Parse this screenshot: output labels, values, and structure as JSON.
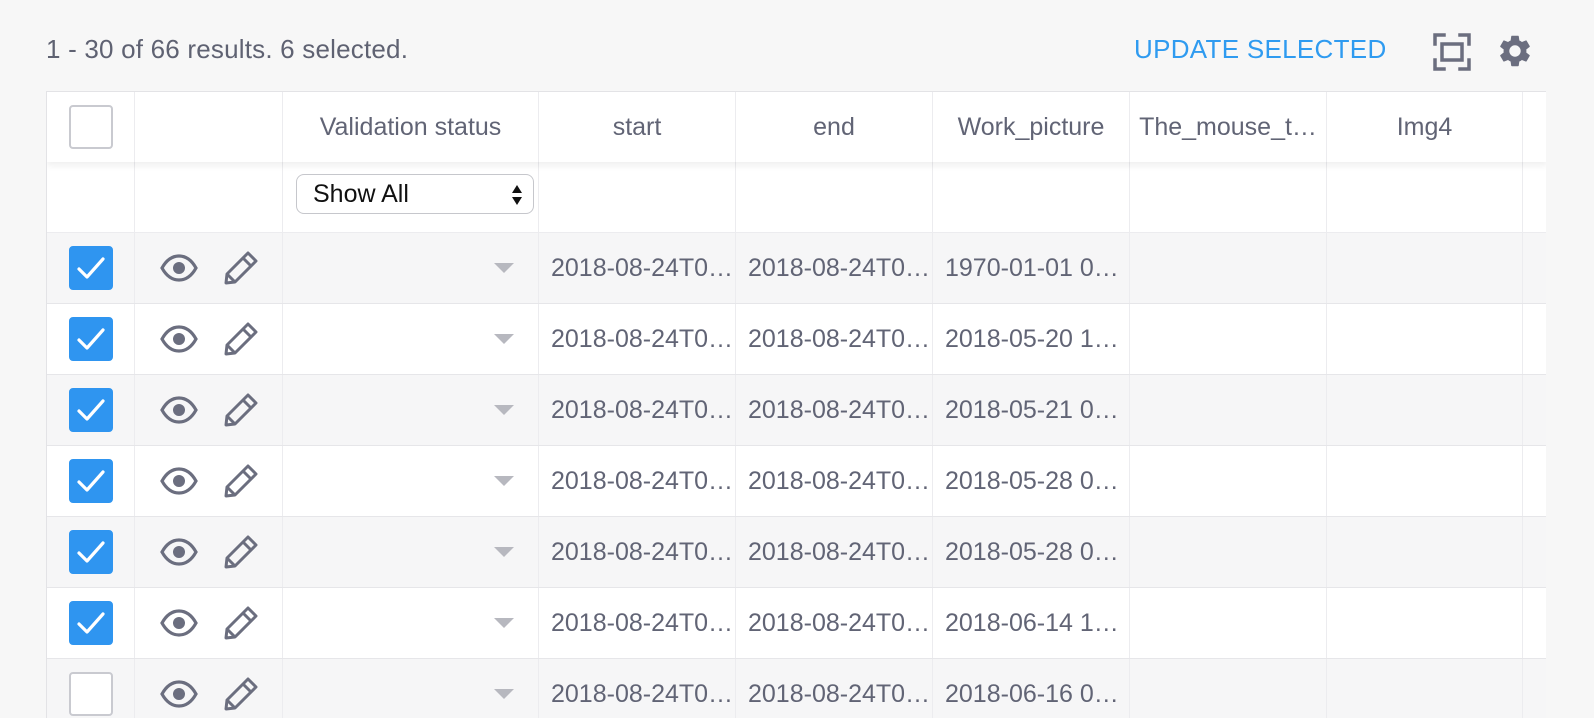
{
  "results_text": "1 - 30 of 66 results. 6 selected.",
  "update_selected_label": "UPDATE SELECTED",
  "icons": {
    "fullscreen": "fullscreen-icon",
    "settings": "gear-icon",
    "view": "eye-icon",
    "edit": "pencil-icon"
  },
  "colors": {
    "accent": "#2f95f0",
    "text": "#616475"
  },
  "columns": [
    "",
    "",
    "Validation status",
    "start",
    "end",
    "Work_picture",
    "The_mouse_t…",
    "Img4"
  ],
  "filter": {
    "validation_status": "Show All"
  },
  "rows": [
    {
      "checked": true,
      "start": "2018-08-24T0…",
      "end": "2018-08-24T0…",
      "work_picture": "1970-01-01 0…"
    },
    {
      "checked": true,
      "start": "2018-08-24T0…",
      "end": "2018-08-24T0…",
      "work_picture": "2018-05-20 1…"
    },
    {
      "checked": true,
      "start": "2018-08-24T0…",
      "end": "2018-08-24T0…",
      "work_picture": "2018-05-21 0…"
    },
    {
      "checked": true,
      "start": "2018-08-24T0…",
      "end": "2018-08-24T0…",
      "work_picture": "2018-05-28 0…"
    },
    {
      "checked": true,
      "start": "2018-08-24T0…",
      "end": "2018-08-24T0…",
      "work_picture": "2018-05-28 0…"
    },
    {
      "checked": true,
      "start": "2018-08-24T0…",
      "end": "2018-08-24T0…",
      "work_picture": "2018-06-14 1…"
    },
    {
      "checked": false,
      "start": "2018-08-24T0…",
      "end": "2018-08-24T0…",
      "work_picture": "2018-06-16 0…"
    }
  ]
}
